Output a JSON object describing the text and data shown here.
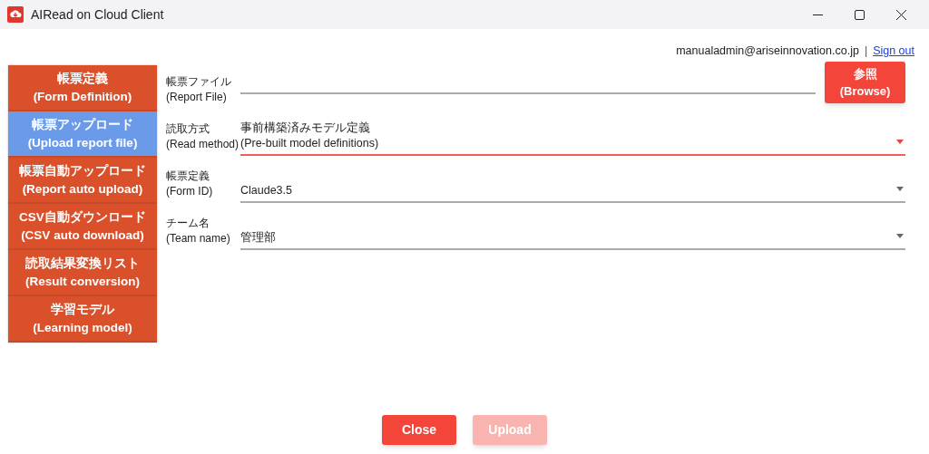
{
  "window": {
    "title": "AIRead on Cloud Client"
  },
  "user": {
    "email": "manualadmin@ariseinnovation.co.jp",
    "separator": "|",
    "sign_out": "Sign out"
  },
  "sidebar": {
    "items": [
      {
        "label": "帳票定義\n(Form Definition)",
        "selected": false
      },
      {
        "label": "帳票アップロード\n(Upload report file)",
        "selected": true
      },
      {
        "label": "帳票自動アップロード\n(Report auto upload)",
        "selected": false
      },
      {
        "label": "CSV自動ダウンロード\n(CSV auto download)",
        "selected": false
      },
      {
        "label": "読取結果変換リスト\n(Result conversion)",
        "selected": false
      },
      {
        "label": "学習モデル\n(Learning model)",
        "selected": false
      }
    ]
  },
  "form": {
    "fields": [
      {
        "kind": "file",
        "label": "帳票ファイル\n(Report File)",
        "button": "参照\n(Browse)",
        "focused": false
      },
      {
        "kind": "select",
        "label": "読取方式\n(Read method)",
        "value": "事前構築済みモデル定義\n(Pre-built model definitions)",
        "focused": true
      },
      {
        "kind": "select",
        "label": "帳票定義\n(Form ID)",
        "value": "Claude3.5",
        "focused": false
      },
      {
        "kind": "select",
        "label": "チーム名\n(Team name)",
        "value": "管理部",
        "focused": false
      }
    ]
  },
  "buttons": [
    {
      "label": "Close",
      "disabled": false
    },
    {
      "label": "Upload",
      "disabled": true
    }
  ]
}
